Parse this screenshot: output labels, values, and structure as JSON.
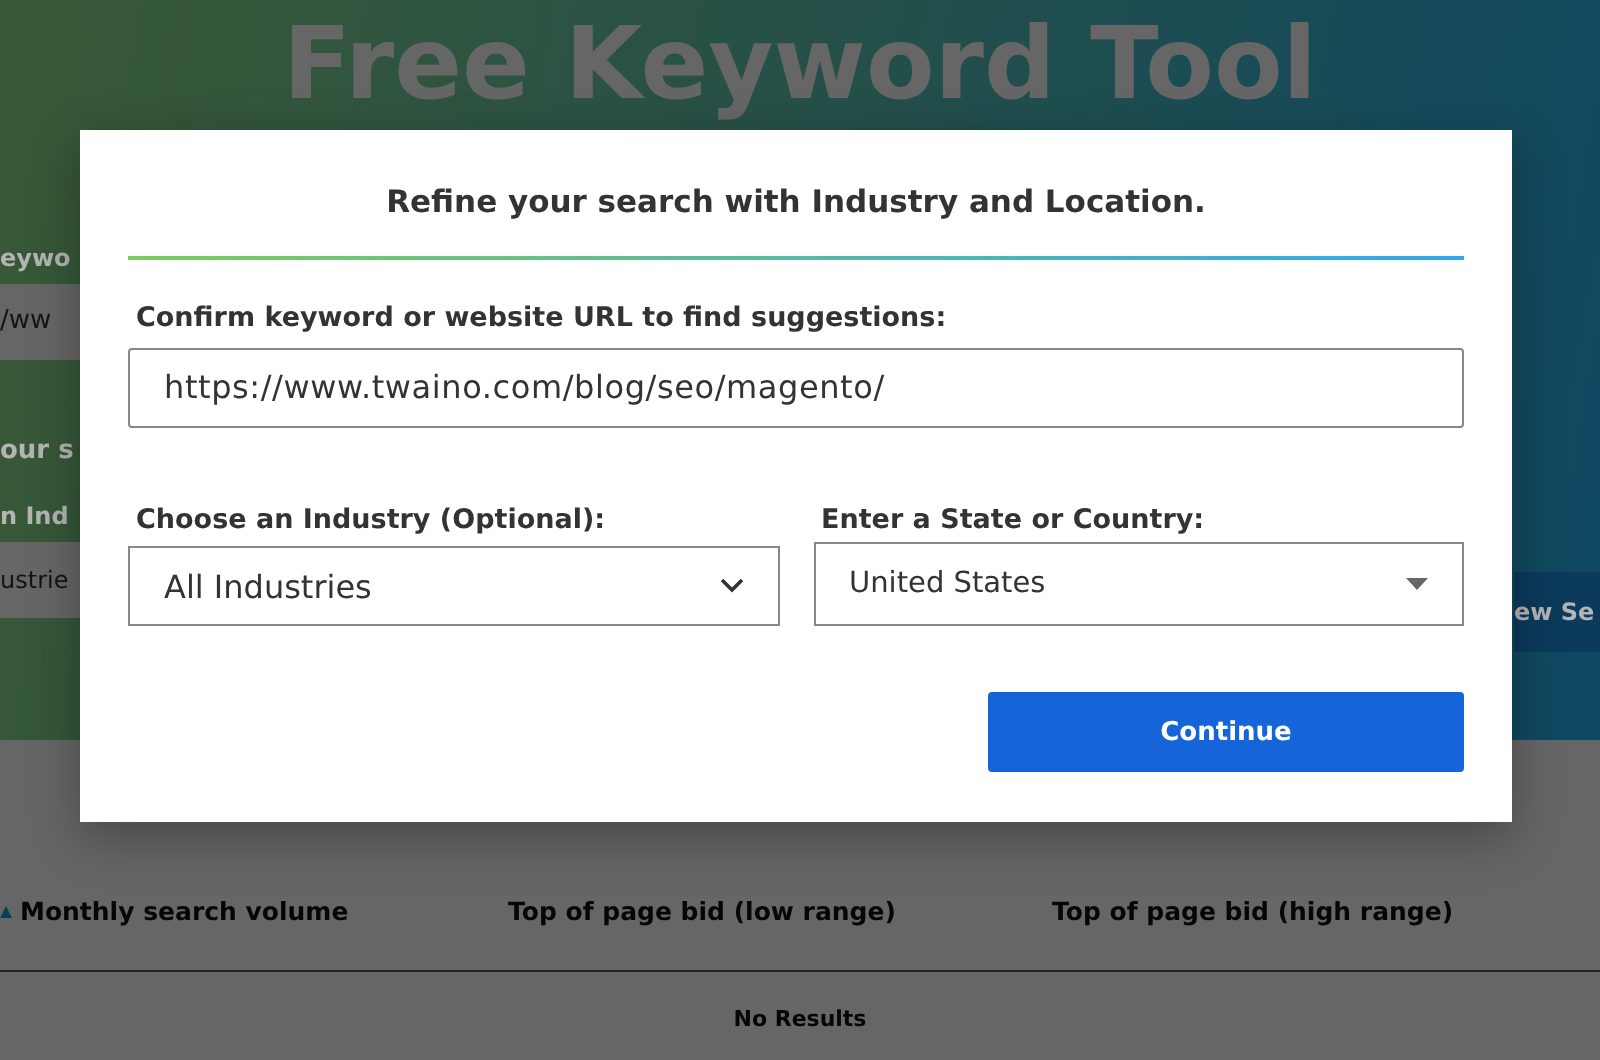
{
  "background_page": {
    "title": "Free Keyword Tool",
    "keyword_label": "eywo",
    "keyword_input": "/ww",
    "search_heading": "our s",
    "industry_label": "n Ind",
    "industry_select": "ustrie",
    "search_button": "ew Se"
  },
  "table": {
    "columns": [
      {
        "label": "Monthly search volume",
        "sorted": true
      },
      {
        "label": "Top of page bid (low range)",
        "sorted": false
      },
      {
        "label": "Top of page bid (high range)",
        "sorted": false
      }
    ],
    "empty_message": "No Results"
  },
  "dialog": {
    "title": "Refine your search with Industry and Location.",
    "url_label": "Confirm keyword or website URL to find suggestions:",
    "url_value": "https://www.twaino.com/blog/seo/magento/",
    "industry_label": "Choose an Industry (Optional):",
    "industry_value": "All Industries",
    "location_label": "Enter a State or Country:",
    "location_value": "United States",
    "button": "Continue"
  }
}
